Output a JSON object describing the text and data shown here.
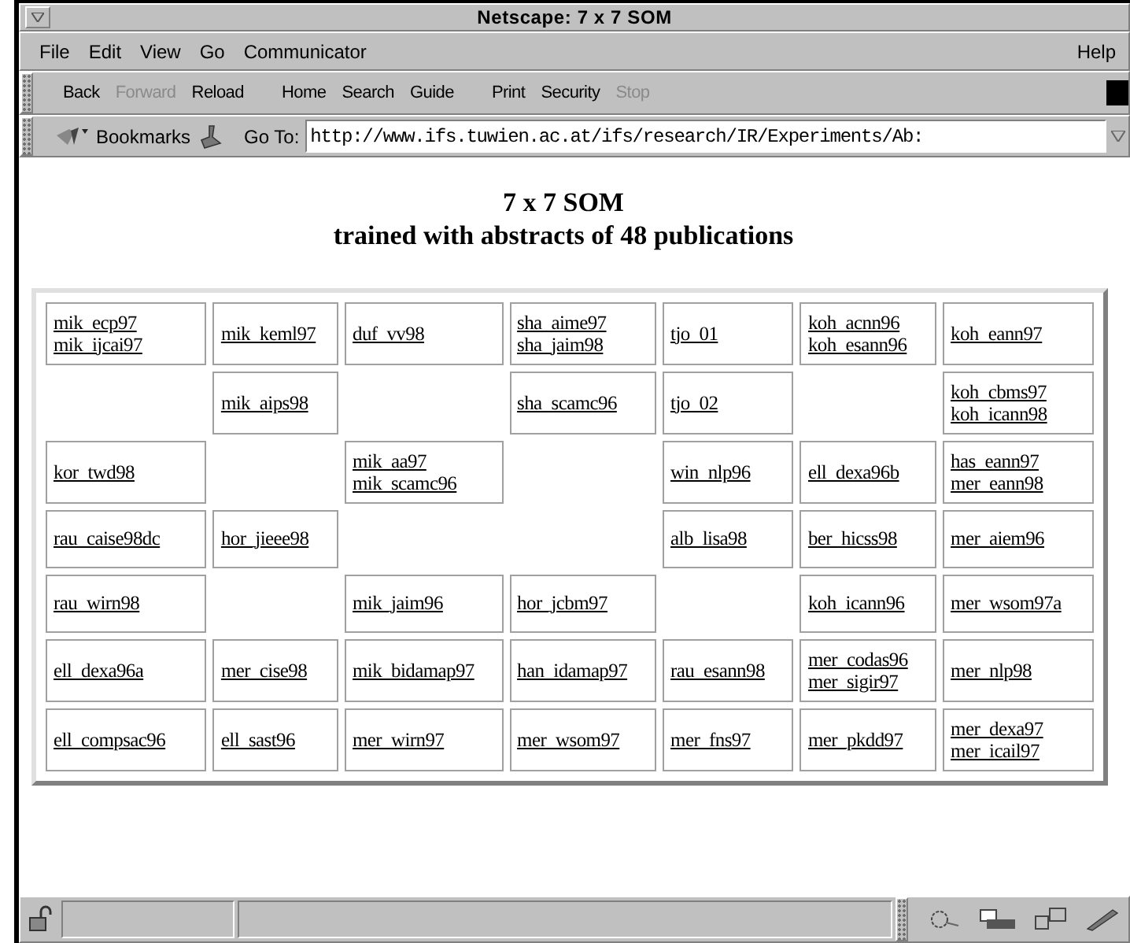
{
  "window": {
    "title": "Netscape: 7 x 7 SOM"
  },
  "menu": {
    "left": [
      "File",
      "Edit",
      "View",
      "Go",
      "Communicator"
    ],
    "right": "Help"
  },
  "toolbar": [
    {
      "label": "Back",
      "disabled": false
    },
    {
      "label": "Forward",
      "disabled": true
    },
    {
      "label": "Reload",
      "disabled": false
    },
    {
      "label": "Home",
      "disabled": false
    },
    {
      "label": "Search",
      "disabled": false
    },
    {
      "label": "Guide",
      "disabled": false
    },
    {
      "label": "Print",
      "disabled": false
    },
    {
      "label": "Security",
      "disabled": false
    },
    {
      "label": "Stop",
      "disabled": true
    }
  ],
  "location_bar": {
    "bookmarks": "Bookmarks",
    "goto_label": "Go To:",
    "url": "http://www.ifs.tuwien.ac.at/ifs/research/IR/Experiments/Ab:"
  },
  "page": {
    "title": "7 x 7 SOM",
    "subtitle": "trained with abstracts of 48 publications"
  },
  "som_grid": [
    [
      {
        "kind": "links",
        "links": [
          "mik_ecp97",
          "mik_ijcai97"
        ]
      },
      {
        "kind": "links",
        "links": [
          "mik_keml97"
        ]
      },
      {
        "kind": "links",
        "links": [
          "duf_vv98"
        ]
      },
      {
        "kind": "links",
        "links": [
          "sha_aime97",
          "sha_jaim98"
        ]
      },
      {
        "kind": "links",
        "links": [
          "tjo_01"
        ]
      },
      {
        "kind": "links",
        "links": [
          "koh_acnn96",
          "koh_esann96"
        ]
      },
      {
        "kind": "links",
        "links": [
          "koh_eann97"
        ]
      }
    ],
    [
      {
        "kind": "empty"
      },
      {
        "kind": "links",
        "links": [
          "mik_aips98"
        ]
      },
      {
        "kind": "empty"
      },
      {
        "kind": "links",
        "links": [
          "sha_scamc96"
        ]
      },
      {
        "kind": "links",
        "links": [
          "tjo_02"
        ]
      },
      {
        "kind": "empty"
      },
      {
        "kind": "links",
        "links": [
          "koh_cbms97",
          "koh_icann98"
        ]
      }
    ],
    [
      {
        "kind": "links",
        "links": [
          "kor_twd98"
        ]
      },
      {
        "kind": "empty"
      },
      {
        "kind": "links",
        "links": [
          "mik_aa97",
          "mik_scamc96"
        ]
      },
      {
        "kind": "empty"
      },
      {
        "kind": "links",
        "links": [
          "win_nlp96"
        ]
      },
      {
        "kind": "links",
        "links": [
          "ell_dexa96b"
        ]
      },
      {
        "kind": "links",
        "links": [
          "has_eann97",
          "mer_eann98"
        ]
      }
    ],
    [
      {
        "kind": "links",
        "links": [
          "rau_caise98dc"
        ]
      },
      {
        "kind": "links",
        "links": [
          "hor_jieee98"
        ]
      },
      {
        "kind": "empty"
      },
      {
        "kind": "empty"
      },
      {
        "kind": "links",
        "links": [
          "alb_lisa98"
        ]
      },
      {
        "kind": "links",
        "links": [
          "ber_hicss98"
        ]
      },
      {
        "kind": "links",
        "links": [
          "mer_aiem96"
        ]
      }
    ],
    [
      {
        "kind": "links",
        "links": [
          "rau_wirn98"
        ]
      },
      {
        "kind": "empty"
      },
      {
        "kind": "links",
        "links": [
          "mik_jaim96"
        ]
      },
      {
        "kind": "links",
        "links": [
          "hor_jcbm97"
        ]
      },
      {
        "kind": "empty"
      },
      {
        "kind": "links",
        "links": [
          "koh_icann96"
        ]
      },
      {
        "kind": "links",
        "links": [
          "mer_wsom97a"
        ]
      }
    ],
    [
      {
        "kind": "links",
        "links": [
          "ell_dexa96a"
        ]
      },
      {
        "kind": "links",
        "links": [
          "mer_cise98"
        ]
      },
      {
        "kind": "links",
        "links": [
          "mik_bidamap97"
        ]
      },
      {
        "kind": "links",
        "links": [
          "han_idamap97"
        ]
      },
      {
        "kind": "links",
        "links": [
          "rau_esann98"
        ]
      },
      {
        "kind": "links",
        "links": [
          "mer_codas96",
          "mer_sigir97"
        ]
      },
      {
        "kind": "links",
        "links": [
          "mer_nlp98"
        ]
      }
    ],
    [
      {
        "kind": "links",
        "links": [
          "ell_compsac96"
        ]
      },
      {
        "kind": "links",
        "links": [
          "ell_sast96"
        ]
      },
      {
        "kind": "links",
        "links": [
          "mer_wirn97"
        ]
      },
      {
        "kind": "links",
        "links": [
          "mer_wsom97"
        ]
      },
      {
        "kind": "links",
        "links": [
          "mer_fns97"
        ]
      },
      {
        "kind": "links",
        "links": [
          "mer_pkdd97"
        ]
      },
      {
        "kind": "links",
        "links": [
          "mer_dexa97",
          "mer_icail97"
        ]
      }
    ]
  ]
}
